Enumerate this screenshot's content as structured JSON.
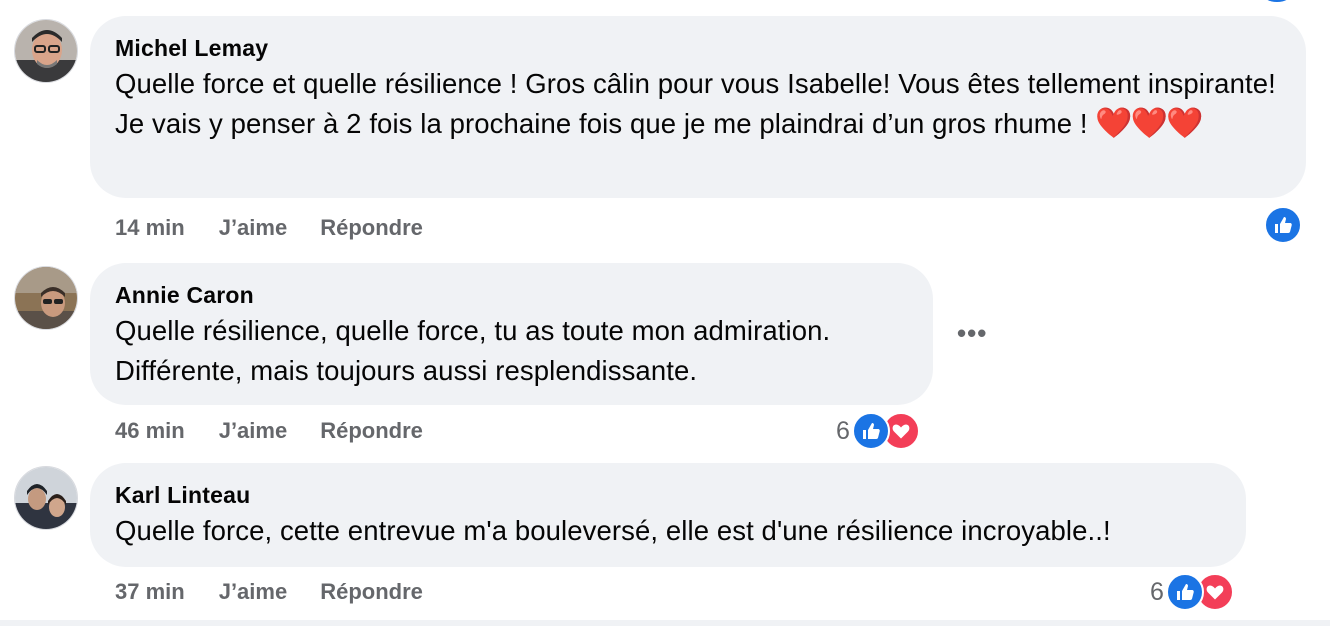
{
  "comments": [
    {
      "author": "Michel Lemay",
      "text": "Quelle force et quelle résilience ! Gros câlin pour vous Isabelle! Vous êtes tellement inspirante! Je vais y penser à 2 fois la prochaine fois que je me plaindrai d’un gros rhume !",
      "emoji": "❤️❤️❤️",
      "time": "14 min",
      "like_label": "J’aime",
      "reply_label": "Répondre"
    },
    {
      "author": "Annie Caron",
      "text": "Quelle résilience, quelle force, tu as toute mon admiration. Différente, mais toujours aussi resplendissante.",
      "time": "46 min",
      "like_label": "J’aime",
      "reply_label": "Répondre",
      "reaction_count": "6",
      "more_label": "•••"
    },
    {
      "author": "Karl Linteau",
      "text": "Quelle force, cette entrevue m'a bouleversé, elle est d'une résilience incroyable..!",
      "time": "37 min",
      "like_label": "J’aime",
      "reply_label": "Répondre",
      "reaction_count": "6"
    }
  ],
  "colors": {
    "like_blue": "#1b74e4",
    "love_red": "#f33e58",
    "bubble_bg": "#f0f2f5",
    "meta_gray": "#65676b"
  },
  "icons": [
    "like-icon",
    "love-icon",
    "more-options-icon"
  ]
}
